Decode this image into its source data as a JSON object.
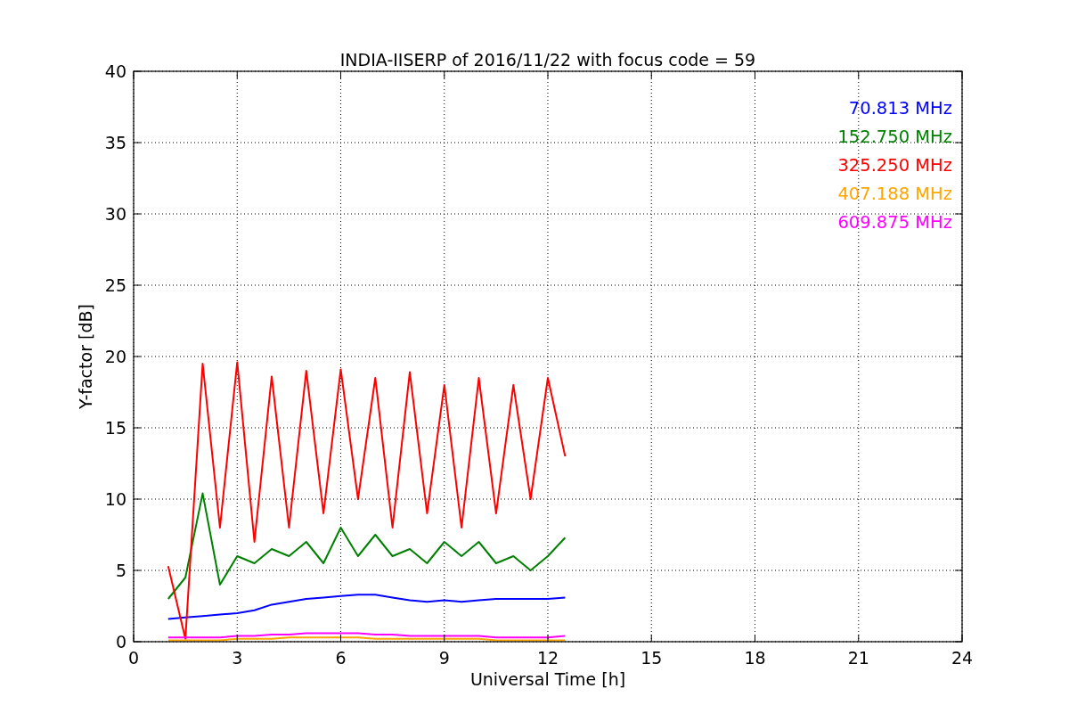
{
  "figure": {
    "chart_data": {
      "type": "line",
      "title": "INDIA-IISERP of 2016/11/22 with focus code = 59",
      "xlabel": "Universal Time [h]",
      "ylabel": "Y-factor [dB]",
      "x": [
        1,
        1.5,
        2,
        2.5,
        3,
        3.5,
        4,
        4.5,
        5,
        5.5,
        6,
        6.5,
        7,
        7.5,
        8,
        8.5,
        9,
        9.5,
        10,
        10.5,
        11,
        11.5,
        12,
        12.5
      ],
      "series": [
        {
          "name": "70.813 MHz",
          "color": "#0000ff",
          "values": [
            1.6,
            1.7,
            1.8,
            1.9,
            2.0,
            2.2,
            2.6,
            2.8,
            3.0,
            3.1,
            3.2,
            3.3,
            3.3,
            3.1,
            2.9,
            2.8,
            2.9,
            2.8,
            2.9,
            3.0,
            3.0,
            3.0,
            3.0,
            3.1
          ]
        },
        {
          "name": "152.750 MHz",
          "color": "#008000",
          "values": [
            3.0,
            4.5,
            10.4,
            4.0,
            6.0,
            5.5,
            6.5,
            6.0,
            7.0,
            5.5,
            8.0,
            6.0,
            7.5,
            6.0,
            6.5,
            5.5,
            7.0,
            6.0,
            7.0,
            5.5,
            6.0,
            5.0,
            6.0,
            7.3
          ]
        },
        {
          "name": "325.250 MHz",
          "color": "#ff0000",
          "values": [
            5.3,
            0.2,
            19.5,
            8.0,
            19.6,
            7.0,
            18.6,
            8.0,
            19.0,
            9.0,
            19.1,
            10.0,
            18.5,
            8.0,
            18.9,
            9.0,
            18.0,
            8.0,
            18.5,
            9.0,
            18.0,
            10.0,
            18.5,
            13.0
          ]
        },
        {
          "name": "407.188 MHz",
          "color": "#ffa500",
          "values": [
            0.1,
            0.1,
            0.1,
            0.1,
            0.2,
            0.2,
            0.2,
            0.3,
            0.3,
            0.3,
            0.3,
            0.3,
            0.2,
            0.2,
            0.2,
            0.2,
            0.2,
            0.2,
            0.2,
            0.1,
            0.1,
            0.1,
            0.1,
            0.1
          ]
        },
        {
          "name": "609.875 MHz",
          "color": "#ff00ff",
          "values": [
            0.3,
            0.3,
            0.3,
            0.3,
            0.4,
            0.4,
            0.5,
            0.5,
            0.6,
            0.6,
            0.6,
            0.6,
            0.5,
            0.5,
            0.4,
            0.4,
            0.4,
            0.4,
            0.4,
            0.3,
            0.3,
            0.3,
            0.3,
            0.4
          ]
        }
      ],
      "grid": true,
      "xlim": [
        0,
        24
      ],
      "ylim": [
        0,
        40
      ],
      "xticks": [
        0,
        3,
        6,
        9,
        12,
        15,
        18,
        21,
        24
      ],
      "yticks": [
        0,
        5,
        10,
        15,
        20,
        25,
        30,
        35,
        40
      ]
    }
  }
}
